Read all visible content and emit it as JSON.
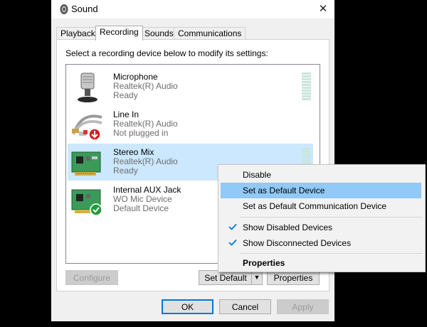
{
  "window": {
    "title": "Sound",
    "close_glyph": "✕"
  },
  "tabs": [
    {
      "label": "Playback",
      "active": false
    },
    {
      "label": "Recording",
      "active": true
    },
    {
      "label": "Sounds",
      "active": false
    },
    {
      "label": "Communications",
      "active": false
    }
  ],
  "instruction": "Select a recording device below to modify its settings:",
  "devices": [
    {
      "name": "Microphone",
      "driver": "Realtek(R) Audio",
      "status": "Ready",
      "icon": "microphone-icon",
      "selected": false
    },
    {
      "name": "Line In",
      "driver": "Realtek(R) Audio",
      "status": "Not plugged in",
      "icon": "line-in-cable-icon",
      "badge": "red-down-arrow",
      "selected": false
    },
    {
      "name": "Stereo Mix",
      "driver": "Realtek(R) Audio",
      "status": "Ready",
      "icon": "sound-card-icon",
      "selected": true
    },
    {
      "name": "Internal AUX Jack",
      "driver": "WO Mic Device",
      "status": "Default Device",
      "icon": "sound-card-icon",
      "badge": "green-check",
      "selected": false
    }
  ],
  "buttons": {
    "configure": "Configure",
    "set_default": "Set Default",
    "set_default_arrow": "▼",
    "properties": "Properties",
    "ok": "OK",
    "cancel": "Cancel",
    "apply": "Apply"
  },
  "context_menu": {
    "items": [
      {
        "label": "Disable"
      },
      {
        "label": "Set as Default Device",
        "highlighted": true
      },
      {
        "label": "Set as Default Communication Device"
      },
      {
        "label": "Show Disabled Devices",
        "checked": true
      },
      {
        "label": "Show Disconnected Devices",
        "checked": true
      },
      {
        "label": "Properties",
        "bold": true
      }
    ]
  },
  "colors": {
    "selection": "#cce8ff",
    "menu_highlight": "#91c9f7",
    "check": "#0078d7",
    "default_badge": "#1f9c3a",
    "unplugged_badge": "#d32020"
  }
}
